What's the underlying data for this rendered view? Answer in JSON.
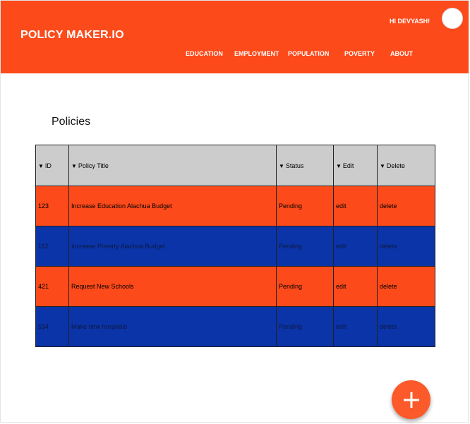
{
  "header": {
    "brand": "POLICY MAKER.IO",
    "greeting": "HI DEVYASH!",
    "nav": [
      "EDUCATION",
      "EMPLOYMENT",
      "POPULATION",
      "POVERTY",
      "ABOUT"
    ]
  },
  "main": {
    "title": "Policies",
    "table": {
      "sort_icon": "caret-down-icon",
      "columns": [
        "ID",
        "Policy Title",
        "Status",
        "Edit",
        "Delete"
      ],
      "rows": [
        {
          "id": "123",
          "title": "Increase Education Alachua Budget",
          "status": "Pending",
          "edit": "edit",
          "delete": "delete"
        },
        {
          "id": "112",
          "title": "Increase Poverty Alachua Budget",
          "status": "Pending",
          "edit": "edit",
          "delete": "delete"
        },
        {
          "id": "421",
          "title": "Request New Schools",
          "status": "Pending",
          "edit": "edit",
          "delete": "delete"
        },
        {
          "id": "534",
          "title": "Make new hospitals",
          "status": "Pending",
          "edit": "edit",
          "delete": "delete"
        }
      ]
    }
  },
  "fab": {
    "icon": "plus-icon"
  },
  "colors": {
    "header": "#fc4a1a",
    "row_orange": "#fc4a1a",
    "row_blue": "#0a34a8",
    "table_header": "#cccccc",
    "fab": "#fc5a2a"
  }
}
